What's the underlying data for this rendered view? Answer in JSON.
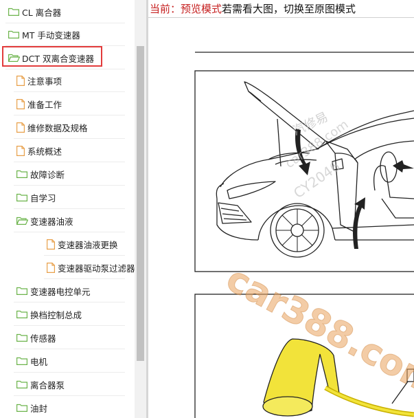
{
  "sidebar": {
    "items": [
      {
        "label": "CL 离合器",
        "type": "folder"
      },
      {
        "label": "MT 手动变速器",
        "type": "folder"
      },
      {
        "label": "DCT 双离合变速器",
        "type": "folder-open",
        "selected": true
      },
      {
        "label": "注意事项",
        "type": "page"
      },
      {
        "label": "准备工作",
        "type": "page"
      },
      {
        "label": "维修数据及规格",
        "type": "page"
      },
      {
        "label": "系统概述",
        "type": "page"
      },
      {
        "label": "故障诊断",
        "type": "folder"
      },
      {
        "label": "自学习",
        "type": "folder"
      },
      {
        "label": "变速器油液",
        "type": "folder-open"
      },
      {
        "label": "变速器油液更换",
        "type": "page"
      },
      {
        "label": "变速器驱动泵过滤器",
        "type": "page"
      },
      {
        "label": "变速器电控单元",
        "type": "folder"
      },
      {
        "label": "换档控制总成",
        "type": "folder"
      },
      {
        "label": "传感器",
        "type": "folder"
      },
      {
        "label": "电机",
        "type": "folder"
      },
      {
        "label": "离合器泵",
        "type": "folder"
      },
      {
        "label": "油封",
        "type": "folder"
      }
    ]
  },
  "mode_bar": {
    "prefix": "当前：预览模式",
    "suffix": "若需看大图，切换至原图模式"
  },
  "watermarks": {
    "main": "car388.com",
    "faint_1": "汽修易",
    "faint_2": "car388.com",
    "faint_3": "CY2046"
  },
  "colors": {
    "folder_green": "#6bb34a",
    "page_orange": "#e8a04a",
    "selection_red": "#e23b3b",
    "mode_red": "#c62020",
    "funnel_yellow": "#f2e33a",
    "watermark_orange": "#e9a25c"
  }
}
